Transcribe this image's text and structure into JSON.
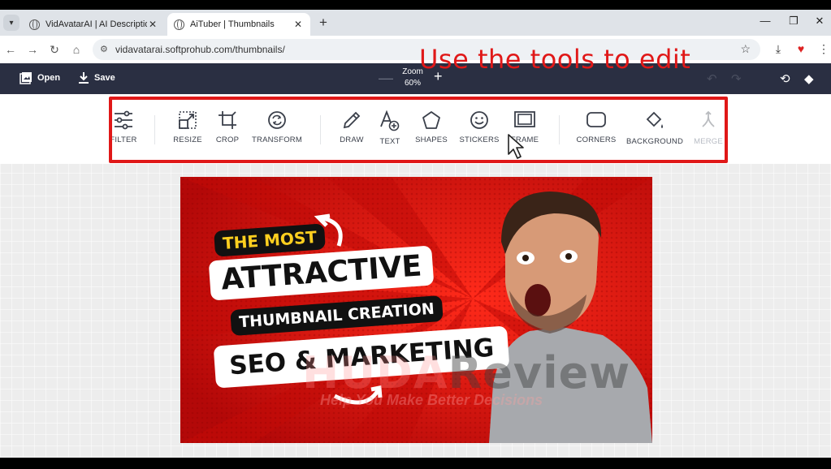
{
  "tabs": [
    {
      "title": "VidAvatarAI | AI Description"
    },
    {
      "title": "AiTuber | Thumbnails"
    }
  ],
  "address": {
    "url": "vidavatarai.softprohub.com/thumbnails/"
  },
  "overlay": {
    "caption": "Use the tools to edit"
  },
  "header": {
    "open_label": "Open",
    "save_label": "Save",
    "zoom_label": "Zoom",
    "zoom_value": "60%"
  },
  "tools": [
    {
      "label": "FILTER",
      "icon": "sliders-icon"
    },
    {
      "label": "RESIZE",
      "icon": "resize-icon"
    },
    {
      "label": "CROP",
      "icon": "crop-icon"
    },
    {
      "label": "TRANSFORM",
      "icon": "rotate-icon"
    },
    {
      "label": "DRAW",
      "icon": "pencil-icon"
    },
    {
      "label": "TEXT",
      "icon": "text-icon"
    },
    {
      "label": "SHAPES",
      "icon": "pentagon-icon"
    },
    {
      "label": "STICKERS",
      "icon": "smiley-icon"
    },
    {
      "label": "FRAME",
      "icon": "frame-icon"
    },
    {
      "label": "CORNERS",
      "icon": "rounded-square-icon"
    },
    {
      "label": "BACKGROUND",
      "icon": "paint-bucket-icon"
    },
    {
      "label": "MERGE",
      "icon": "merge-icon"
    }
  ],
  "thumbnail": {
    "line1": "THE MOST",
    "line2": "ATTRACTIVE",
    "line3": "THUMBNAIL CREATION",
    "line4": "SEO & MARKETING",
    "watermark_a": "HUDA",
    "watermark_b": "Review",
    "watermark_tagline": "Help You Make Better Decisions"
  },
  "colors": {
    "accent_red": "#e01818",
    "header_bg": "#2a2f42",
    "thumb_red": "#e3140f",
    "label_yellow": "#ffcf1f"
  }
}
